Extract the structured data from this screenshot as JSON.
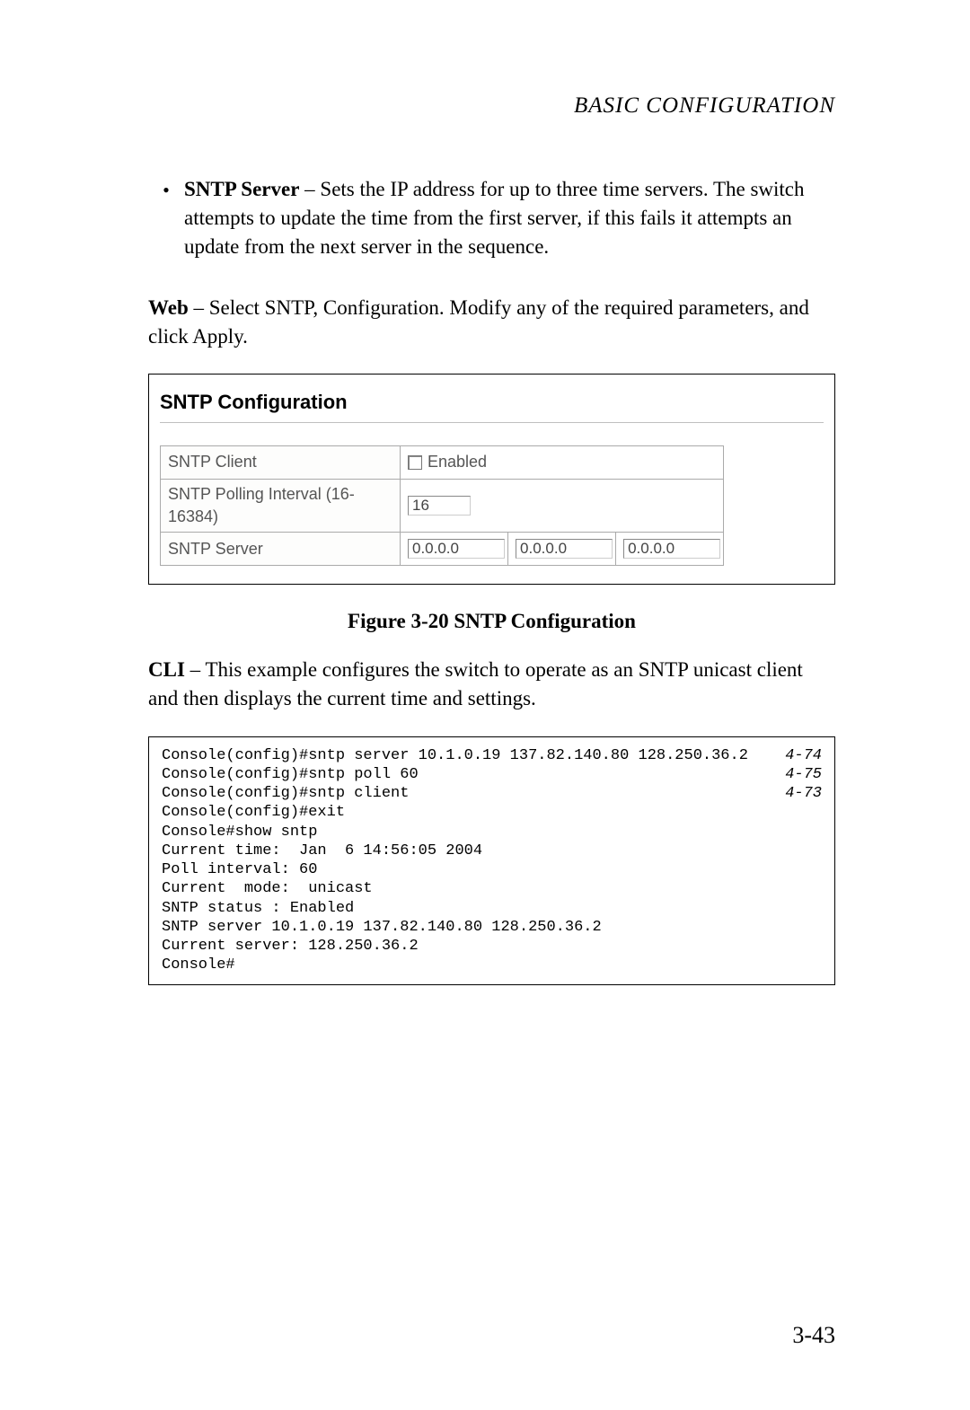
{
  "header": "BASIC CONFIGURATION",
  "bullet": {
    "marker": "•",
    "term": "SNTP Server",
    "separator": " – ",
    "desc": "Sets the IP address for up to three time servers. The switch attempts to update the time from the first server, if this fails it attempts an update from the next server in the sequence."
  },
  "web_para": {
    "lead": "Web",
    "rest": " – Select SNTP, Configuration. Modify any of the required parameters, and click Apply."
  },
  "ui": {
    "title": "SNTP Configuration",
    "rows": {
      "client_label": "SNTP Client",
      "client_enabled_label": "Enabled",
      "interval_label": "SNTP Polling Interval (16-16384)",
      "interval_value": "16",
      "server_label": "SNTP Server",
      "server_values": [
        "0.0.0.0",
        "0.0.0.0",
        "0.0.0.0"
      ]
    }
  },
  "figure_caption": "Figure 3-20  SNTP Configuration",
  "cli_para": {
    "lead": "CLI",
    "rest": " – This example configures the switch to operate as an SNTP unicast client and then displays the current time and settings."
  },
  "cli": {
    "lines": [
      {
        "text": "Console(config)#sntp server 10.1.0.19 137.82.140.80 128.250.36.2",
        "ref": "4-74"
      },
      {
        "text": "Console(config)#sntp poll 60",
        "ref": "4-75"
      },
      {
        "text": "Console(config)#sntp client",
        "ref": "4-73"
      },
      {
        "text": "Console(config)#exit",
        "ref": ""
      },
      {
        "text": "Console#show sntp",
        "ref": ""
      },
      {
        "text": "Current time:  Jan  6 14:56:05 2004",
        "ref": ""
      },
      {
        "text": "Poll interval: 60",
        "ref": ""
      },
      {
        "text": "Current  mode:  unicast",
        "ref": ""
      },
      {
        "text": "SNTP status : Enabled",
        "ref": ""
      },
      {
        "text": "SNTP server 10.1.0.19 137.82.140.80 128.250.36.2",
        "ref": ""
      },
      {
        "text": "Current server: 128.250.36.2",
        "ref": ""
      },
      {
        "text": "Console#",
        "ref": ""
      }
    ]
  },
  "page_number": "3-43"
}
